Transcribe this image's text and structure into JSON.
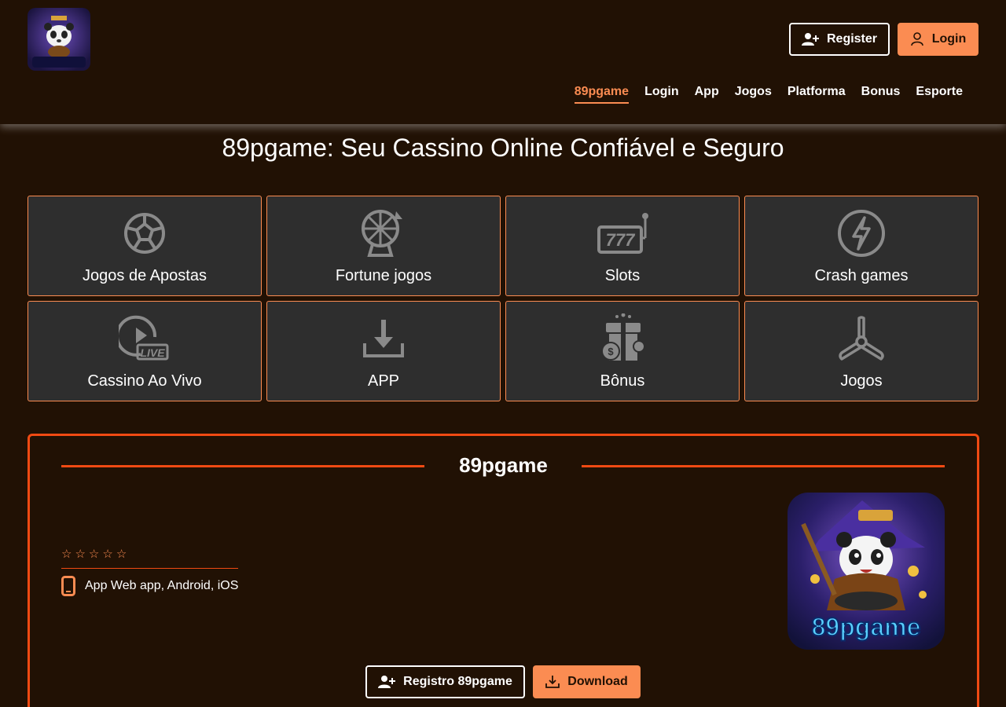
{
  "header": {
    "logo_alt": "89pgame",
    "register_label": "Register",
    "login_label": "Login"
  },
  "nav": {
    "items": [
      "89pgame",
      "Login",
      "App",
      "Jogos",
      "Platforma",
      "Bonus",
      "Esporte"
    ],
    "active": "89pgame"
  },
  "page_title": "89pgame: Seu Cassino Online Confiável e Seguro",
  "tiles": [
    {
      "label": "Jogos de Apostas",
      "icon": "soccer-ball-icon"
    },
    {
      "label": "Fortune jogos",
      "icon": "fortune-wheel-icon"
    },
    {
      "label": "Slots",
      "icon": "slot-machine-icon"
    },
    {
      "label": "Crash games",
      "icon": "lightning-icon"
    },
    {
      "label": "Cassino Ao Vivo",
      "icon": "live-play-icon"
    },
    {
      "label": "APP",
      "icon": "download-icon"
    },
    {
      "label": "Bônus",
      "icon": "gift-icon"
    },
    {
      "label": "Jogos",
      "icon": "propeller-icon"
    }
  ],
  "app_panel": {
    "title": "89pgame",
    "rating_stars": 5,
    "star_glyph": "☆",
    "platforms": "App Web app, Android, iOS",
    "app_image_text": "89pgame",
    "register_button": "Registro 89pgame",
    "download_button": "Download"
  },
  "colors": {
    "background": "#211104",
    "accent": "#fb8c52",
    "panel_border": "#f04a13",
    "tile_bg": "#2e2e2e",
    "icon_gray": "#8a8a8a"
  }
}
